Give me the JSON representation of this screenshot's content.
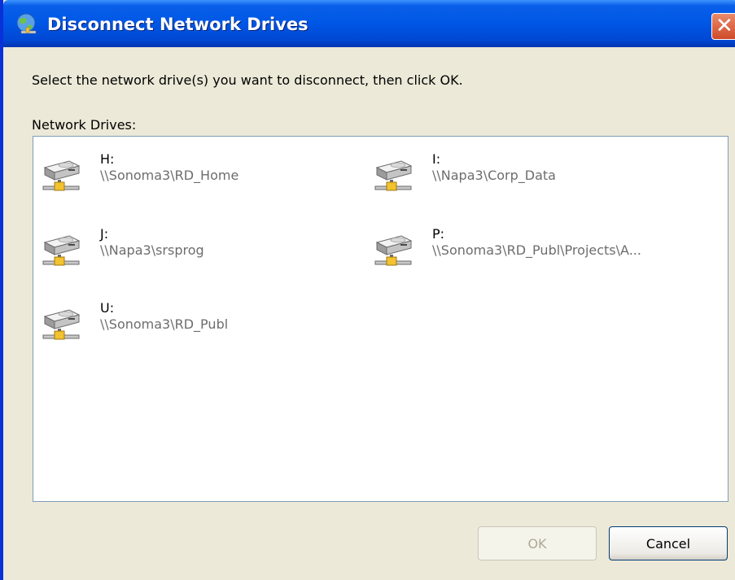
{
  "window": {
    "title": "Disconnect Network Drives",
    "close_glyph": "✕"
  },
  "instruction": "Select the network drive(s) you want to disconnect, then click OK.",
  "list_label": "Network Drives:",
  "drives": [
    {
      "letter": "H:",
      "path": "\\\\Sonoma3\\RD_Home",
      "icon": "network-drive-icon"
    },
    {
      "letter": "I:",
      "path": "\\\\Napa3\\Corp_Data",
      "icon": "network-drive-icon"
    },
    {
      "letter": "J:",
      "path": "\\\\Napa3\\srsprog",
      "icon": "network-drive-icon"
    },
    {
      "letter": "P:",
      "path": "\\\\Sonoma3\\RD_Publ\\Projects\\A...",
      "icon": "network-drive-icon"
    },
    {
      "letter": "U:",
      "path": "\\\\Sonoma3\\RD_Publ",
      "icon": "network-drive-icon"
    }
  ],
  "buttons": {
    "ok_label": "OK",
    "ok_enabled": false,
    "cancel_label": "Cancel"
  },
  "colors": {
    "titlebar": "#0058e6",
    "dialog_bg": "#ece9d8",
    "path_text": "#6d6d6d",
    "close_button": "#cf4a29"
  }
}
